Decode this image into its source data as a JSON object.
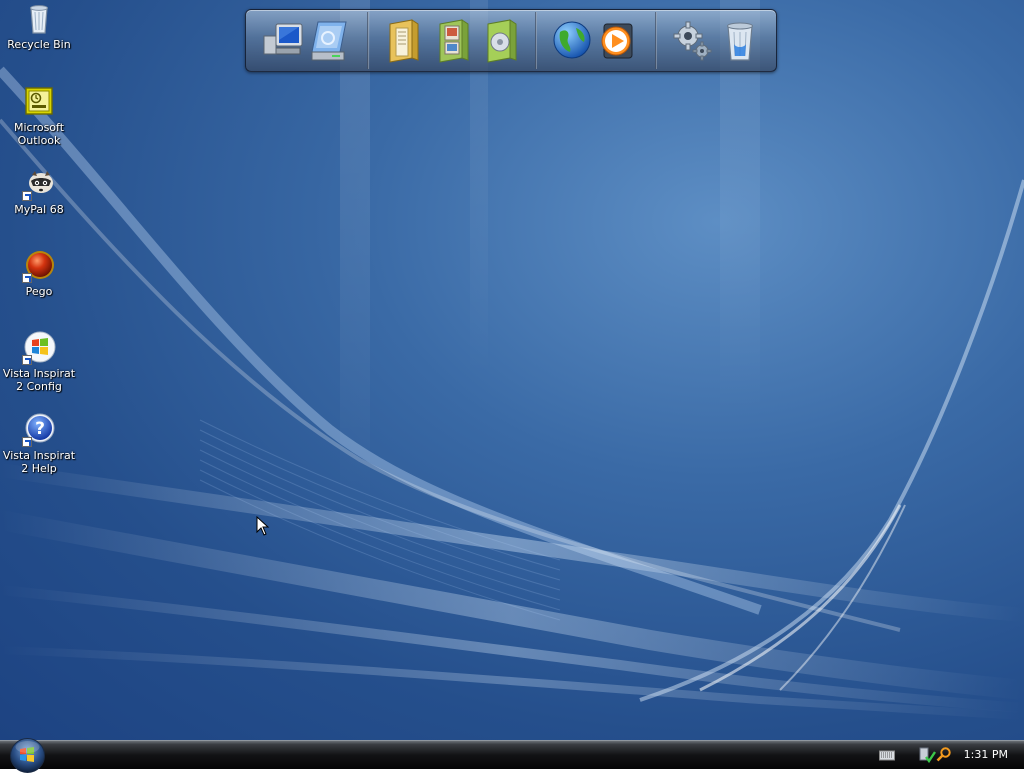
{
  "desktop": {
    "icons": [
      {
        "id": "recycle-bin",
        "label": "Recycle Bin",
        "icon": "recycle-bin-icon",
        "shortcut": false
      },
      {
        "id": "microsoft-outlook",
        "label": "Microsoft Outlook",
        "icon": "outlook-icon",
        "shortcut": false
      },
      {
        "id": "mypal-68",
        "label": "MyPal 68",
        "icon": "raccoon-browser-icon",
        "shortcut": true
      },
      {
        "id": "pego",
        "label": "Pego",
        "icon": "red-ball-icon",
        "shortcut": true
      },
      {
        "id": "vista-inspirat-config",
        "label": "Vista Inspirat 2 Config",
        "icon": "windows-logo-icon",
        "shortcut": true
      },
      {
        "id": "vista-inspirat-help",
        "label": "Vista Inspirat 2 Help",
        "icon": "help-icon",
        "shortcut": true
      }
    ]
  },
  "dock": {
    "groups": [
      [
        "my-computer-icon",
        "drive-icon"
      ],
      [
        "documents-folder-icon",
        "pictures-folder-icon",
        "music-folder-icon"
      ],
      [
        "internet-globe-icon",
        "media-player-icon"
      ],
      [
        "control-panel-gears-icon",
        "recycle-bin-icon"
      ]
    ]
  },
  "taskbar": {
    "start_icon": "windows-orb-icon",
    "tray_icons": [
      "keyboard-icon",
      "security-shield-icon",
      "search-icon"
    ],
    "clock": "1:31 PM"
  },
  "colors": {
    "desktop_blue": "#2a5b9a",
    "taskbar": "#0a0a0a",
    "label_text": "#ffffff"
  }
}
